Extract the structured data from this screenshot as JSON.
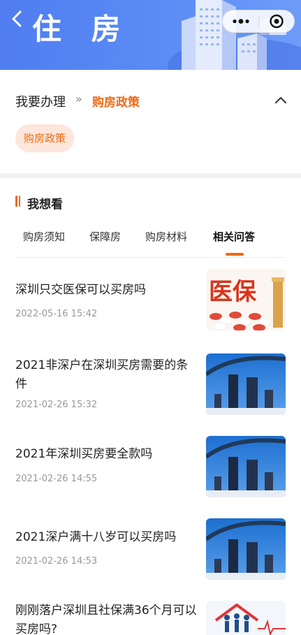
{
  "header": {
    "title": "住 房",
    "back_icon": "chevron-left-icon",
    "capsule_icons": [
      "more-dots-icon",
      "close-circle-icon"
    ]
  },
  "breadcrumb": {
    "main": "我要办理",
    "separator": "»",
    "current": "购房政策",
    "collapse_icon": "chevron-up-icon"
  },
  "chip": {
    "label": "购房政策"
  },
  "section": {
    "title": "我想看"
  },
  "tabs": [
    {
      "label": "购房须知",
      "active": false
    },
    {
      "label": "保障房",
      "active": false
    },
    {
      "label": "购房材料",
      "active": false
    },
    {
      "label": "相关问答",
      "active": true
    }
  ],
  "articles": [
    {
      "title": "深圳只交医保可以买房吗",
      "time": "2022-05-16 15:42",
      "thumb": "medical-insurance-image",
      "thumb_text": "医保"
    },
    {
      "title": "2021非深户在深圳买房需要的条件",
      "time": "2021-02-26 15:32",
      "thumb": "city-skyline-image"
    },
    {
      "title": "2021年深圳买房要全款吗",
      "time": "2021-02-26 14:55",
      "thumb": "city-skyline-image"
    },
    {
      "title": "2021深户满十八岁可以买房吗",
      "time": "2021-02-26 14:53",
      "thumb": "city-skyline-image"
    },
    {
      "title": "刚刚落户深圳且社保满36个月可以买房吗?",
      "time": "",
      "thumb": "family-house-image"
    }
  ],
  "colors": {
    "accent": "#f06a14",
    "header_blue": "#5b8cf5",
    "chip_bg": "#fde6db"
  }
}
